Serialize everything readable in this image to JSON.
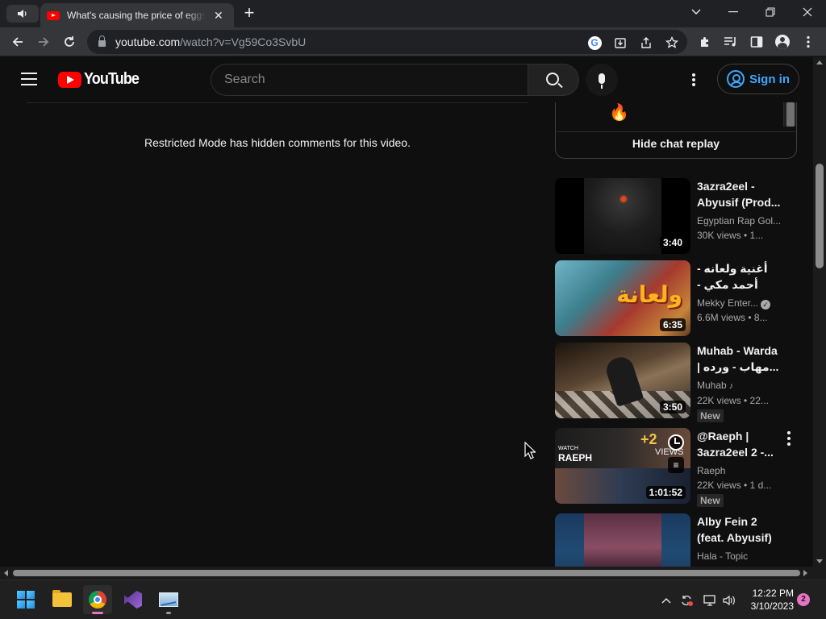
{
  "browser": {
    "tab_title": "What's causing the price of eggs to rise so much? | CNN Business",
    "tab_close": "✕",
    "new_tab": "+",
    "url_host": "youtube.com",
    "url_path": "/watch?v=Vg59Co3SvbU",
    "window_controls": {
      "minimize": "—",
      "maximize": "❐",
      "close": "✕",
      "tab_search": "⌄"
    }
  },
  "youtube": {
    "logo_text": "YouTube",
    "search_placeholder": "Search",
    "signin_label": "Sign in",
    "restricted_text": "Restricted Mode has hidden comments for this video.",
    "chat_emoji": "🔥",
    "hide_chat_label": "Hide chat replay",
    "recommendations": [
      {
        "title": "3azra2eel - Abyusif (Prod...",
        "channel": "Egyptian Rap Gol...",
        "meta": "30K views  • 1...",
        "duration": "3:40"
      },
      {
        "title": "أغنية ولعانه - أحمد مكي - الكبير الجزء...",
        "channel": "Mekky Enter...",
        "meta": "6.6M views  • 8...",
        "duration": "6:35",
        "verified": true,
        "thumb_text": "ولعانة"
      },
      {
        "title": "Muhab - Warda | مهاب - ورده...",
        "channel": "Muhab",
        "meta": "22K views  • 22...",
        "duration": "3:50",
        "badge": "New",
        "music_note": "♪"
      },
      {
        "title": "@Raeph | 3azra2eel 2 -...",
        "channel": "Raeph",
        "meta": "22K views  • 1 d...",
        "duration": "1:01:52",
        "badge": "New",
        "thumb_watch": "WATCH",
        "thumb_raeph": "RAEPH",
        "thumb_plus": "+2",
        "thumb_views": "VIEWS"
      },
      {
        "title": "Alby Fein 2 (feat. Abyusif)",
        "channel": "Hala - Topic"
      }
    ]
  },
  "taskbar": {
    "time": "12:22 PM",
    "date": "3/10/2023",
    "notification_count": "2"
  }
}
